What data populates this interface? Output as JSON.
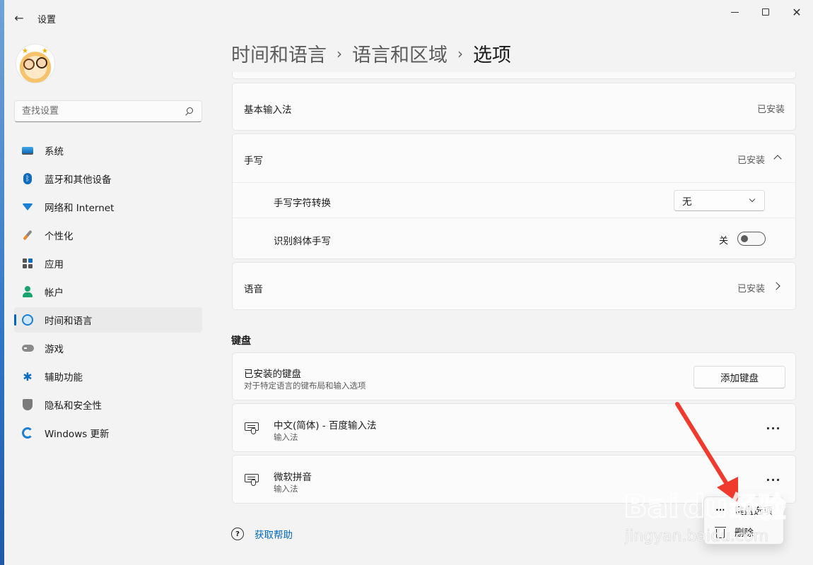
{
  "window": {
    "app_title": "设置",
    "back_icon": "arrow-left-icon",
    "controls": {
      "minimize": "minimize-icon",
      "maximize": "maximize-icon",
      "close": "close-icon"
    }
  },
  "sidebar": {
    "search_placeholder": "查找设置",
    "items": [
      {
        "label": "系统",
        "icon": "system-icon",
        "active": false
      },
      {
        "label": "蓝牙和其他设备",
        "icon": "bluetooth-icon",
        "active": false
      },
      {
        "label": "网络和 Internet",
        "icon": "wifi-icon",
        "active": false
      },
      {
        "label": "个性化",
        "icon": "brush-icon",
        "active": false
      },
      {
        "label": "应用",
        "icon": "apps-icon",
        "active": false
      },
      {
        "label": "帐户",
        "icon": "account-icon",
        "active": false
      },
      {
        "label": "时间和语言",
        "icon": "time-language-icon",
        "active": true
      },
      {
        "label": "游戏",
        "icon": "gamepad-icon",
        "active": false
      },
      {
        "label": "辅助功能",
        "icon": "accessibility-icon",
        "active": false
      },
      {
        "label": "隐私和安全性",
        "icon": "shield-icon",
        "active": false
      },
      {
        "label": "Windows 更新",
        "icon": "update-icon",
        "active": false
      }
    ]
  },
  "breadcrumb": {
    "items": [
      "时间和语言",
      "语言和区域",
      "选项"
    ],
    "separator": "›"
  },
  "features": {
    "basic_input": {
      "label": "基本输入法",
      "status": "已安装"
    },
    "handwriting": {
      "label": "手写",
      "status": "已安装",
      "char_conversion": {
        "label": "手写字符转换",
        "value": "无"
      },
      "italic": {
        "label": "识别斜体手写",
        "state": "关",
        "on": false
      }
    },
    "speech": {
      "label": "语音",
      "status": "已安装"
    }
  },
  "keyboards": {
    "section_title": "键盘",
    "installed": {
      "title": "已安装的键盘",
      "subtitle": "对于特定语言的键布局和输入选项",
      "add_button": "添加键盘"
    },
    "list": [
      {
        "name": "中文(简体) - 百度输入法",
        "type": "输入法"
      },
      {
        "name": "微软拼音",
        "type": "输入法"
      }
    ],
    "more_label": "···"
  },
  "context_menu": {
    "items": [
      {
        "label": "键盘选项",
        "icon": "more-dots-icon"
      },
      {
        "label": "删除",
        "icon": "trash-icon"
      }
    ]
  },
  "help": {
    "label": "获取帮助"
  },
  "colors": {
    "accent": "#0067c0",
    "annotation_arrow": "#f03a2e"
  }
}
